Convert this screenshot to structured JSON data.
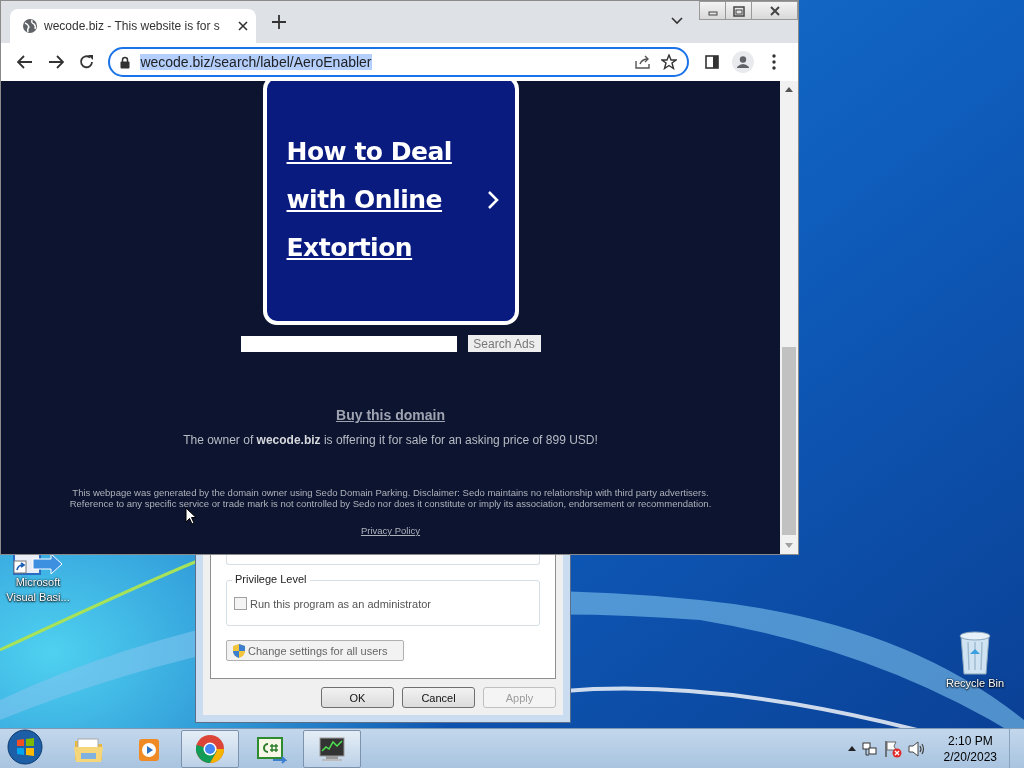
{
  "browser": {
    "tabs": [
      {
        "title": "wecode.biz - This website is for s",
        "selected": true
      }
    ],
    "address": {
      "text": "wecode.biz/search/label/AeroEnabler",
      "selected": true
    },
    "page": {
      "ad_card": {
        "title": "How to Deal with Online Extortion"
      },
      "search_button": "Search Ads",
      "buy_link": "Buy this domain",
      "offer": "The owner of **wecode.biz** is offering it for sale for an asking price of 899 USD!",
      "disclaimer": {
        "before": "This webpage was generated by the domain owner using ",
        "link": "Sedo Domain Parking",
        "lines": [
          ". Disclaimer: Sedo maintains no relationship with third party advertisers.",
          "Reference to any specific service or trade mark is not controlled by Sedo nor does it constitute or imply its association, endorsement or recommendation."
        ]
      },
      "privacy_link": "Privacy Policy"
    }
  },
  "dialog": {
    "group_title": "Privilege Level",
    "checkbox": {
      "label": "Run this program as an administrator",
      "checked": false
    },
    "settings_button": "Change settings for all users",
    "buttons": [
      {
        "label": "OK",
        "disabled": false
      },
      {
        "label": "Cancel",
        "disabled": false
      },
      {
        "label": "Apply",
        "disabled": true
      }
    ]
  },
  "desktop_icons": [
    {
      "kind": "shortcut",
      "label": "Microsoft Visual Basi..."
    },
    {
      "kind": "recycle",
      "label": "Recycle Bin"
    }
  ],
  "taskbar": {
    "items": [
      {
        "kind": "explorer",
        "running": false
      },
      {
        "kind": "media",
        "running": false
      },
      {
        "kind": "chrome",
        "running": true
      },
      {
        "kind": "csharp",
        "running": false
      },
      {
        "kind": "monitor",
        "running": true
      }
    ],
    "time": "2:10 PM",
    "date": "2/20/2023"
  }
}
